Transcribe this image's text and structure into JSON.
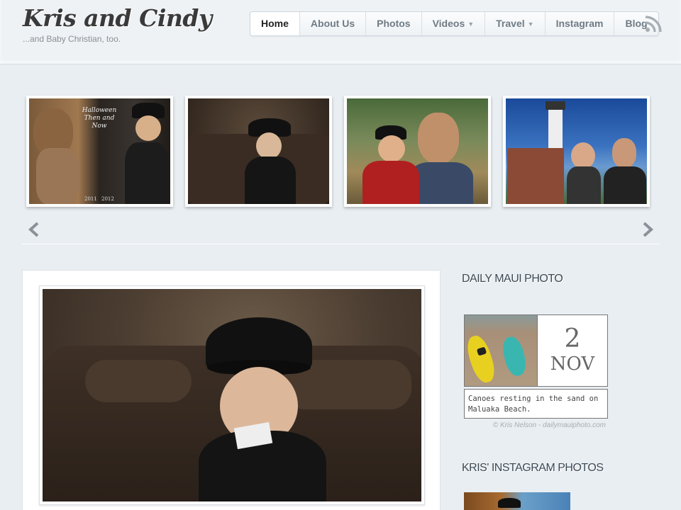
{
  "site": {
    "title": "Kris and Cindy",
    "tagline": "...and Baby Christian, too."
  },
  "nav": {
    "items": [
      {
        "label": "Home",
        "active": true,
        "dropdown": false
      },
      {
        "label": "About Us",
        "active": false,
        "dropdown": false
      },
      {
        "label": "Photos",
        "active": false,
        "dropdown": false
      },
      {
        "label": "Videos",
        "active": false,
        "dropdown": true
      },
      {
        "label": "Travel",
        "active": false,
        "dropdown": true
      },
      {
        "label": "Instagram",
        "active": false,
        "dropdown": false
      },
      {
        "label": "Blog",
        "active": false,
        "dropdown": false
      }
    ],
    "rss_icon": "rss-icon"
  },
  "carousel": {
    "slides": [
      {
        "caption_line1": "Halloween",
        "caption_line2": "Then and Now",
        "year_left": "2011",
        "year_right": "2012"
      },
      {},
      {},
      {}
    ],
    "prev_icon": "arrow-left-icon",
    "next_icon": "arrow-right-icon"
  },
  "sidebar": {
    "maui": {
      "title": "DAILY MAUI PHOTO",
      "day": "2",
      "month": "NOV",
      "caption": "Canoes resting in the sand on Maluaka Beach.",
      "credit": "© Kris Nelson - dailymauiphoto.com"
    },
    "instagram": {
      "title": "KRIS' INSTAGRAM PHOTOS"
    }
  },
  "colors": {
    "background": "#e9eef2",
    "title": "#3a3a3a",
    "nav_text": "#6f7b85"
  }
}
